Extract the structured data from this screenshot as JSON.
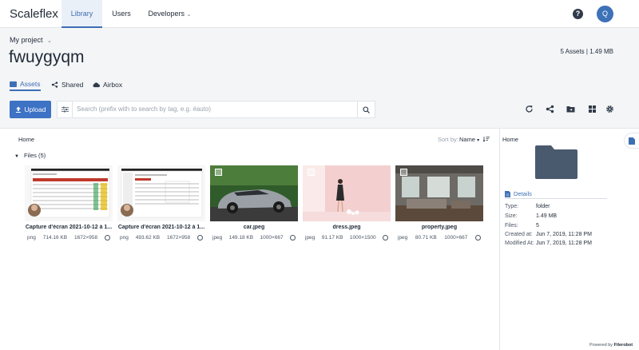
{
  "brand": "Scaleflex",
  "nav": {
    "library": "Library",
    "users": "Users",
    "developers": "Developers",
    "avatar_initial": "Q",
    "help": "?"
  },
  "project": {
    "selector": "My project",
    "title": "fwuygyqm",
    "summary": "5 Assets | 1.49 MB"
  },
  "sub_tabs": {
    "assets": "Assets",
    "shared": "Shared",
    "airbox": "Airbox"
  },
  "toolbar": {
    "upload": "Upload",
    "search_placeholder": "Search (prefix with  to search by tag, e.g. #auto)"
  },
  "listing": {
    "breadcrumb": "Home",
    "sort_label": "Sort by:",
    "sort_value": "Name",
    "folder_title": "Files (5)"
  },
  "files": [
    {
      "name": "Capture d'écran 2021-10-12 à 1...",
      "ext": "png",
      "size": "714.16 KB",
      "dims": "1672×958"
    },
    {
      "name": "Capture d'écran 2021-10-12 à 1...",
      "ext": "png",
      "size": "493.62 KB",
      "dims": "1672×958"
    },
    {
      "name": "car.jpeg",
      "ext": "jpeg",
      "size": "149.18 KB",
      "dims": "1000×667"
    },
    {
      "name": "dress.jpeg",
      "ext": "jpeg",
      "size": "91.17 KB",
      "dims": "1000×1500"
    },
    {
      "name": "property.jpeg",
      "ext": "jpeg",
      "size": "80.71 KB",
      "dims": "1000×667"
    }
  ],
  "details": {
    "home": "Home",
    "tab": "Details",
    "rows": [
      {
        "key": "Type:",
        "value": "folder"
      },
      {
        "key": "Size:",
        "value": "1.49 MB"
      },
      {
        "key": "Files:",
        "value": "5"
      },
      {
        "key": "Created at:",
        "value": "Jun 7, 2019, 11:28 PM"
      },
      {
        "key": "Modified At:",
        "value": "Jun 7, 2019, 11:28 PM"
      }
    ]
  },
  "footer": {
    "powered_prefix": "Powered by",
    "powered_brand": "Filerobot"
  },
  "colors": {
    "accent": "#3d72c4",
    "folder": "#4a5a6e"
  }
}
